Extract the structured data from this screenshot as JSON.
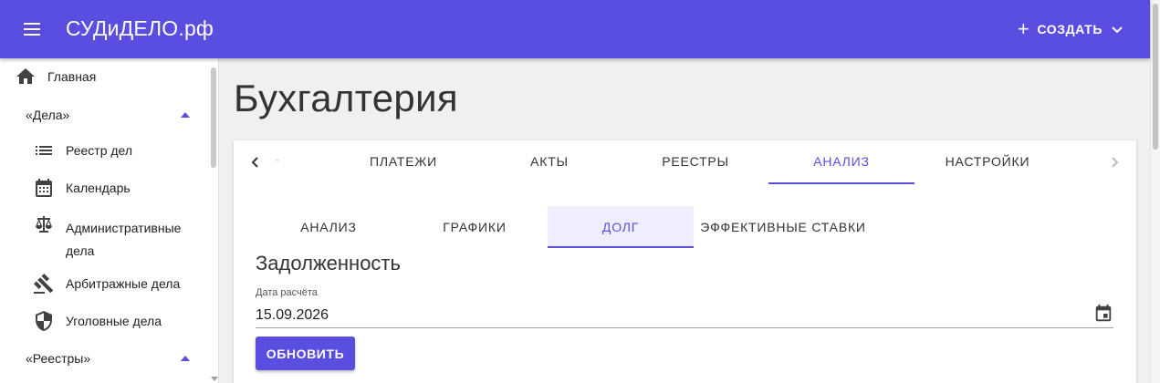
{
  "appbar": {
    "title": "СУДиДЕЛО.рф",
    "create_label": "СОЗДАТЬ"
  },
  "sidebar": {
    "home": "Главная",
    "group_cases": "«Дела»",
    "items": [
      {
        "label": "Реестр дел"
      },
      {
        "label": "Календарь"
      },
      {
        "label": "Административные дела"
      },
      {
        "label": "Арбитражные дела"
      },
      {
        "label": "Уголовные дела"
      }
    ],
    "group_registries": "«Реестры»"
  },
  "page": {
    "title": "Бухгалтерия"
  },
  "tabs": [
    {
      "label": "ПЛАТЕЖИ"
    },
    {
      "label": "АКТЫ"
    },
    {
      "label": "РЕЕСТРЫ"
    },
    {
      "label": "АНАЛИЗ",
      "active": true
    },
    {
      "label": "НАСТРОЙКИ"
    }
  ],
  "subtabs": [
    {
      "label": "АНАЛИЗ"
    },
    {
      "label": "ГРАФИКИ"
    },
    {
      "label": "ДОЛГ",
      "active": true
    },
    {
      "label": "ЭФФЕКТИВНЫЕ СТАВКИ"
    }
  ],
  "debt": {
    "title": "Задолженность",
    "date_label": "Дата расчёта",
    "date_value": "15.09.2026",
    "update_label": "ОБНОВИТЬ"
  },
  "colors": {
    "accent": "#5a4ee0",
    "appbar": "#5a4ee0",
    "active_subtab_bg": "#eeeeff"
  }
}
